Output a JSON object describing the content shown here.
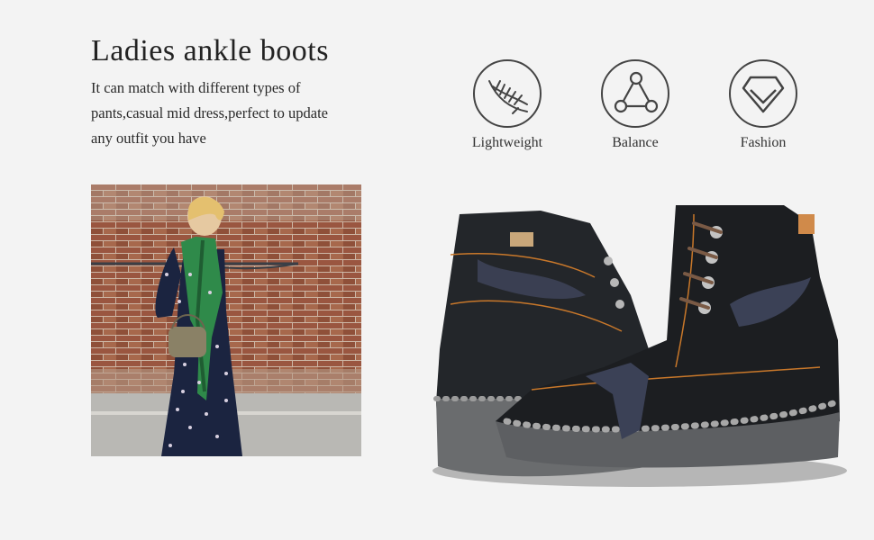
{
  "heading": {
    "title": "Ladies ankle boots",
    "description_lines": [
      "It can match with different types of",
      "pants,casual mid dress,perfect to update",
      "any outfit you have"
    ]
  },
  "features": [
    {
      "label": "Lightweight",
      "icon": "feather-icon"
    },
    {
      "label": "Balance",
      "icon": "triangle-nodes-icon"
    },
    {
      "label": "Fashion",
      "icon": "diamond-icon"
    }
  ],
  "colors": {
    "background": "#f3f3f3",
    "icon_stroke": "#444444",
    "boot_leather": "#1f2124",
    "stitching": "#c9782a",
    "brick": "#9a5a43"
  }
}
